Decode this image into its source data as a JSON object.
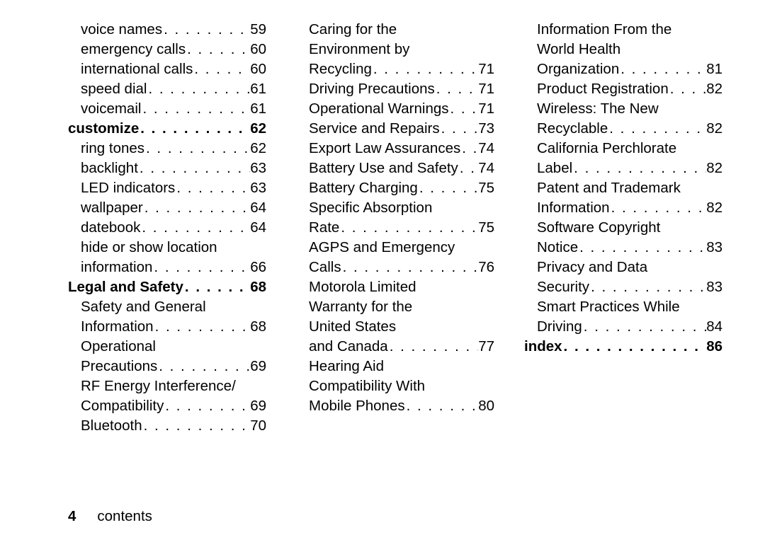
{
  "footer": {
    "page_number": "4",
    "label": "contents"
  },
  "columns": [
    {
      "items": [
        {
          "type": "sub",
          "lines": [
            "voice names"
          ],
          "page": "59"
        },
        {
          "type": "sub",
          "lines": [
            "emergency calls"
          ],
          "page": "60"
        },
        {
          "type": "sub",
          "lines": [
            "international calls"
          ],
          "page": "60"
        },
        {
          "type": "sub",
          "lines": [
            "speed dial"
          ],
          "page": "61"
        },
        {
          "type": "sub",
          "lines": [
            "voicemail"
          ],
          "page": "61"
        },
        {
          "type": "chapter",
          "lines": [
            "customize"
          ],
          "page": "62"
        },
        {
          "type": "sub",
          "lines": [
            "ring tones"
          ],
          "page": "62"
        },
        {
          "type": "sub",
          "lines": [
            "backlight"
          ],
          "page": "63"
        },
        {
          "type": "sub",
          "lines": [
            "LED indicators"
          ],
          "page": "63"
        },
        {
          "type": "sub",
          "lines": [
            "wallpaper"
          ],
          "page": "64"
        },
        {
          "type": "sub",
          "lines": [
            "datebook"
          ],
          "page": "64"
        },
        {
          "type": "sub",
          "lines": [
            "hide or show location",
            "information"
          ],
          "page": "66"
        },
        {
          "type": "chapter",
          "lines": [
            "Legal and Safety"
          ],
          "page": "68"
        },
        {
          "type": "sub",
          "lines": [
            "Safety and General",
            "Information"
          ],
          "page": "68"
        },
        {
          "type": "sub",
          "lines": [
            "Operational",
            "Precautions"
          ],
          "page": "69"
        },
        {
          "type": "sub",
          "lines": [
            "RF Energy Interference/",
            "Compatibility"
          ],
          "page": "69"
        },
        {
          "type": "sub",
          "lines": [
            "Bluetooth"
          ],
          "page": "70"
        }
      ]
    },
    {
      "items": [
        {
          "type": "sub",
          "lines": [
            "Caring for the",
            "Environment by",
            "Recycling"
          ],
          "page": "71"
        },
        {
          "type": "sub",
          "lines": [
            "Driving Precautions"
          ],
          "page": "71"
        },
        {
          "type": "sub",
          "lines": [
            "Operational Warnings"
          ],
          "page": "71"
        },
        {
          "type": "sub",
          "lines": [
            "Service and Repairs"
          ],
          "page": "73"
        },
        {
          "type": "sub",
          "lines": [
            "Export Law Assurances"
          ],
          "page": "74"
        },
        {
          "type": "sub",
          "lines": [
            "Battery Use and Safety"
          ],
          "page": "74"
        },
        {
          "type": "sub",
          "lines": [
            "Battery Charging"
          ],
          "page": "75"
        },
        {
          "type": "sub",
          "lines": [
            "Specific Absorption",
            "Rate"
          ],
          "page": "75"
        },
        {
          "type": "sub",
          "lines": [
            "AGPS and Emergency",
            "Calls"
          ],
          "page": "76"
        },
        {
          "type": "sub",
          "lines": [
            "Motorola Limited",
            "Warranty for the",
            "United States",
            "and Canada"
          ],
          "page": "77"
        },
        {
          "type": "sub",
          "lines": [
            "Hearing Aid",
            "Compatibility With",
            "Mobile Phones"
          ],
          "page": "80"
        }
      ]
    },
    {
      "items": [
        {
          "type": "sub",
          "lines": [
            "Information From the",
            "World Health",
            "Organization"
          ],
          "page": "81"
        },
        {
          "type": "sub",
          "lines": [
            "Product Registration"
          ],
          "page": "82"
        },
        {
          "type": "sub",
          "lines": [
            "Wireless: The New",
            "Recyclable"
          ],
          "page": "82"
        },
        {
          "type": "sub",
          "lines": [
            "California Perchlorate",
            "Label"
          ],
          "page": "82"
        },
        {
          "type": "sub",
          "lines": [
            "Patent and Trademark",
            "Information"
          ],
          "page": "82"
        },
        {
          "type": "sub",
          "lines": [
            "Software Copyright",
            "Notice"
          ],
          "page": "83"
        },
        {
          "type": "sub",
          "lines": [
            "Privacy and Data",
            "Security"
          ],
          "page": "83"
        },
        {
          "type": "sub",
          "lines": [
            "Smart Practices While",
            "Driving"
          ],
          "page": "84"
        },
        {
          "type": "chapter",
          "lines": [
            "index"
          ],
          "page": "86"
        }
      ]
    }
  ]
}
